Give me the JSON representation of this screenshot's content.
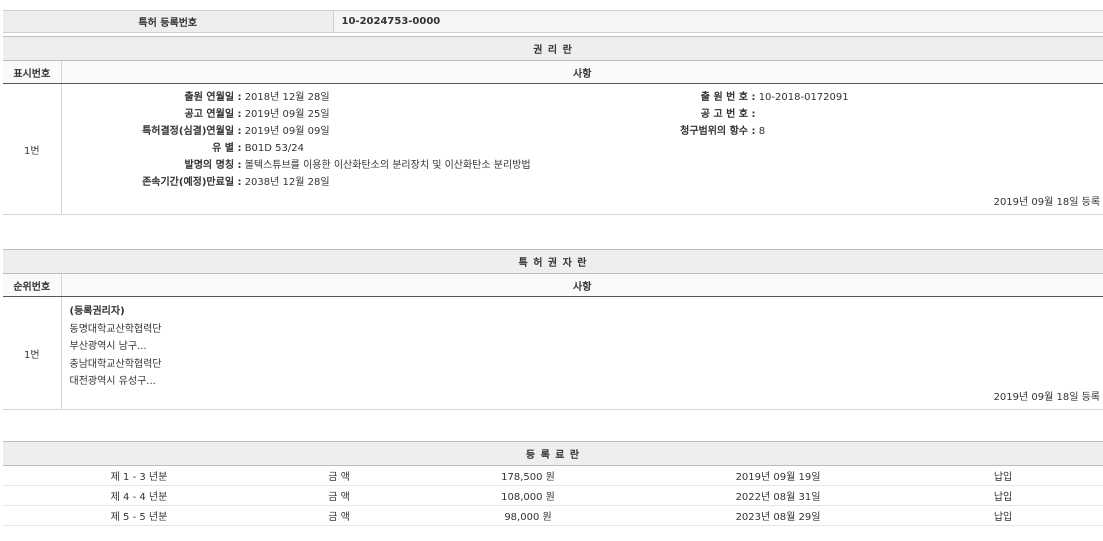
{
  "registration": {
    "label": "특허 등록번호",
    "value": "10-2024753-0000"
  },
  "rights": {
    "title": "권 리 란",
    "col_num": "표시번호",
    "col_content": "사항",
    "row_num": "1번",
    "fields_left": [
      {
        "key": "출원 연월일 :",
        "value": "2018년 12월 28일"
      },
      {
        "key": "공고 연월일 :",
        "value": "2019년 09월 25일"
      },
      {
        "key": "특허결정(심결)연월일 :",
        "value": "2019년 09월 09일"
      },
      {
        "key": "유 별 :",
        "value": "B01D 53/24"
      },
      {
        "key": "발명의 명칭 :",
        "value": "볼텍스튜브를 이용한 이산화탄소의 분리장치 및 이산화탄소 분리방법"
      },
      {
        "key": "존속기간(예정)만료일 :",
        "value": "2038년 12월 28일"
      }
    ],
    "fields_right": [
      {
        "key": "출 원 번 호 :",
        "value": "10-2018-0172091"
      },
      {
        "key": "공 고 번 호 :",
        "value": ""
      },
      {
        "key": "청구범위의 항수 :",
        "value": "8"
      }
    ],
    "stamp": "2019년 09월 18일 등록"
  },
  "owner": {
    "title": "특 허 권 자 란",
    "col_num": "순위번호",
    "col_content": "사항",
    "row_num": "1번",
    "lines": [
      "(등록권리자)",
      "동명대학교산학협력단",
      "부산광역시 남구...",
      "충남대학교산학협력단",
      "대전광역시 유성구..."
    ],
    "stamp": "2019년 09월 18일 등록"
  },
  "fees": {
    "title": "등 록 료 란",
    "rows": [
      {
        "period": "제 1 - 3 년분",
        "label": "금 액",
        "amount": "178,500 원",
        "date": "2019년 09월 19일",
        "status": "납입"
      },
      {
        "period": "제 4 - 4 년분",
        "label": "금 액",
        "amount": "108,000 원",
        "date": "2022년 08월 31일",
        "status": "납입"
      },
      {
        "period": "제 5 - 5 년분",
        "label": "금 액",
        "amount": "98,000 원",
        "date": "2023년 08월 29일",
        "status": "납입"
      }
    ]
  }
}
